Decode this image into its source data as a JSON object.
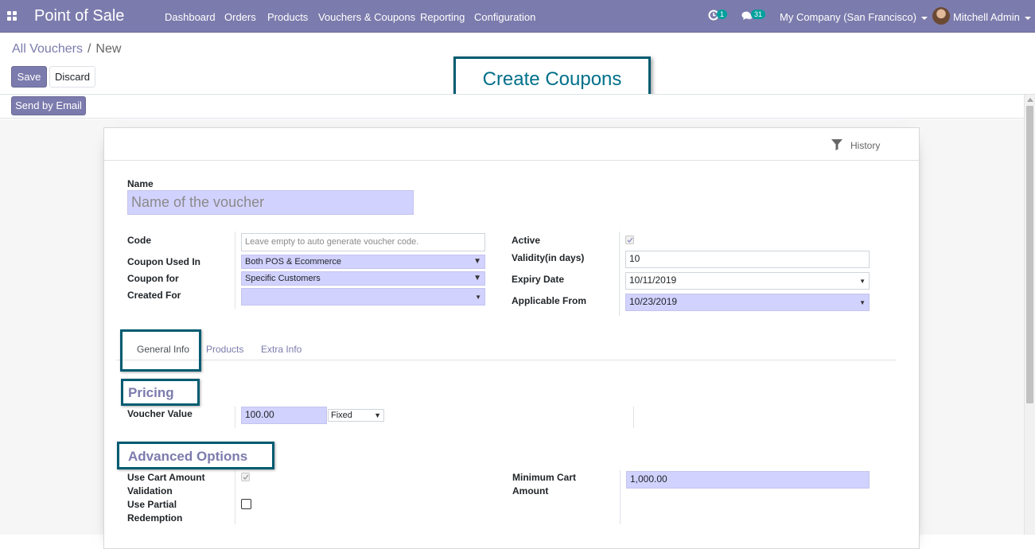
{
  "navbar": {
    "app_name": "Point of Sale",
    "menu": [
      "Dashboard",
      "Orders",
      "Products",
      "Vouchers & Coupons",
      "Reporting",
      "Configuration"
    ],
    "activity_count": "1",
    "messages_count": "31",
    "company": "My Company (San Francisco)",
    "user": "Mitchell Admin"
  },
  "breadcrumb": {
    "parent": "All Vouchers",
    "separator": "/",
    "current": "New"
  },
  "buttons": {
    "save": "Save",
    "discard": "Discard",
    "send_email": "Send by Email"
  },
  "sheet": {
    "history_label": "History",
    "name_label": "Name",
    "name_placeholder": "Name of the voucher",
    "left_fields": {
      "code_label": "Code",
      "code_placeholder": "Leave empty to auto generate voucher code.",
      "used_in_label": "Coupon Used In",
      "used_in_value": "Both POS & Ecommerce",
      "coupon_for_label": "Coupon for",
      "coupon_for_value": "Specific Customers",
      "created_for_label": "Created For",
      "created_for_value": ""
    },
    "right_fields": {
      "active_label": "Active",
      "active_checked": true,
      "validity_label": "Validity(in days)",
      "validity_value": "10",
      "expiry_label": "Expiry Date",
      "expiry_value": "10/11/2019",
      "applicable_label": "Applicable From",
      "applicable_value": "10/23/2019"
    },
    "tabs": [
      "General Info",
      "Products",
      "Extra Info"
    ],
    "active_tab": "General Info",
    "pricing": {
      "title": "Pricing",
      "voucher_value_label": "Voucher Value",
      "voucher_value": "100.00",
      "type_value": "Fixed"
    },
    "advanced": {
      "title": "Advanced Options",
      "cart_validation_label_1": "Use Cart Amount",
      "cart_validation_label_2": "Validation",
      "cart_validation_checked": true,
      "partial_label_1": "Use Partial",
      "partial_label_2": "Redemption",
      "partial_checked": false,
      "min_cart_label_1": "Minimum Cart",
      "min_cart_label_2": "Amount",
      "min_cart_value": "1,000.00"
    }
  },
  "annotation": {
    "callout_text": "Create Coupons"
  },
  "colors": {
    "brand": "#7c7bad",
    "required_field": "#d2d2ff",
    "annotation": "#005b71",
    "badge": "#00a09d"
  },
  "icons": [
    "apps-grid-icon",
    "activity-clock-icon",
    "chat-bubbles-icon",
    "caret-down-icon",
    "filter-funnel-icon",
    "checkmark-icon"
  ]
}
